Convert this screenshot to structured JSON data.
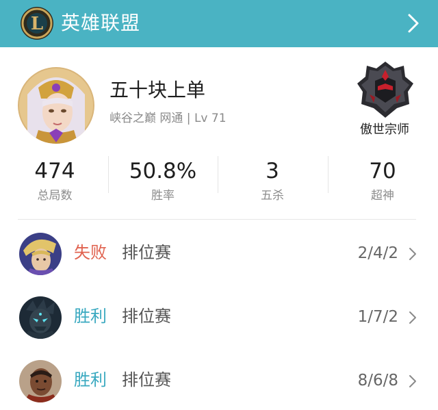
{
  "header": {
    "title": "英雄联盟",
    "logo_letter": "L",
    "accent_color": "#4ab3c3"
  },
  "profile": {
    "name": "五十块上单",
    "meta": "峡谷之巅 网通 | Lv 71",
    "rank": "傲世宗师",
    "avatar_icon": "champion-portrait-icon",
    "rank_icon": "grandmaster-rank-icon"
  },
  "stats": [
    {
      "value": "474",
      "label": "总局数"
    },
    {
      "value": "50.8%",
      "label": "胜率"
    },
    {
      "value": "3",
      "label": "五杀"
    },
    {
      "value": "70",
      "label": "超神"
    }
  ],
  "matches": [
    {
      "result": "失败",
      "result_color": "#e0624f",
      "type": "排位赛",
      "kda": "2/4/2"
    },
    {
      "result": "胜利",
      "result_color": "#3aa9c0",
      "type": "排位赛",
      "kda": "1/7/2"
    },
    {
      "result": "胜利",
      "result_color": "#3aa9c0",
      "type": "排位赛",
      "kda": "8/6/8"
    }
  ]
}
